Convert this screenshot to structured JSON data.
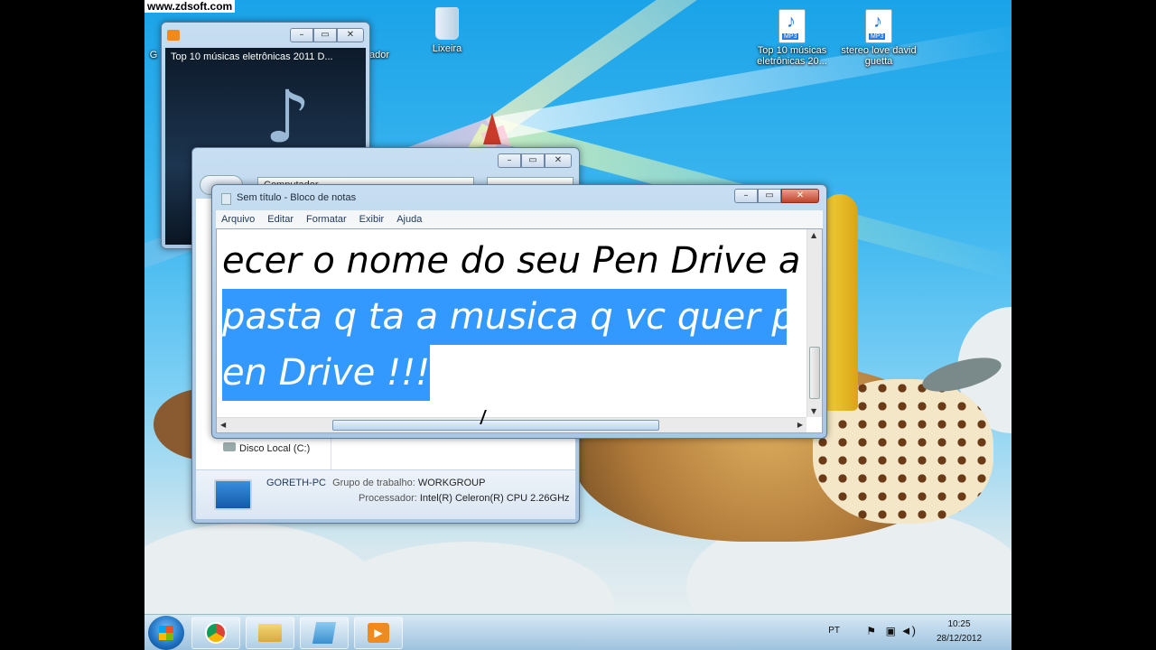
{
  "watermark": "www.zdsoft.com",
  "desktop_icons": [
    {
      "label": "Lixeira",
      "kind": "recycle-bin"
    },
    {
      "label": "Top 10 músicas eletrônicas 20...",
      "kind": "mp3",
      "tag": "MP3"
    },
    {
      "label": "stereo love david guetta",
      "kind": "mp3",
      "tag": "MP3"
    },
    {
      "label": "G",
      "kind": "partial"
    },
    {
      "label": "ador",
      "kind": "partial"
    }
  ],
  "media_player": {
    "title": "Top 10 músicas eletrônicas 2011 D..."
  },
  "explorer": {
    "address": "Computador",
    "nav_item": "Disco Local (C:)",
    "computer_name": "GORETH-PC",
    "workgroup_label": "Grupo de trabalho:",
    "workgroup_value": "WORKGROUP",
    "processor_label": "Processador:",
    "processor_value": "Intel(R) Celeron(R) CPU 2.26GHz"
  },
  "notepad": {
    "title": "Sem título - Bloco de notas",
    "menu": [
      "Arquivo",
      "Editar",
      "Formatar",
      "Exibir",
      "Ajuda"
    ],
    "lines": [
      {
        "text": "ecer o nome do seu Pen Drive a",
        "selected": false
      },
      {
        "text": "pasta q ta a musica q vc quer pa",
        "selected": true
      },
      {
        "text": "en Drive !!!",
        "selected": true
      }
    ],
    "hscroll_fraction": 0.25
  },
  "taskbar": {
    "language": "PT",
    "time": "10:25",
    "date": "28/12/2012"
  },
  "colors": {
    "selection": "#3399ff",
    "sky": "#1aa3e8"
  }
}
